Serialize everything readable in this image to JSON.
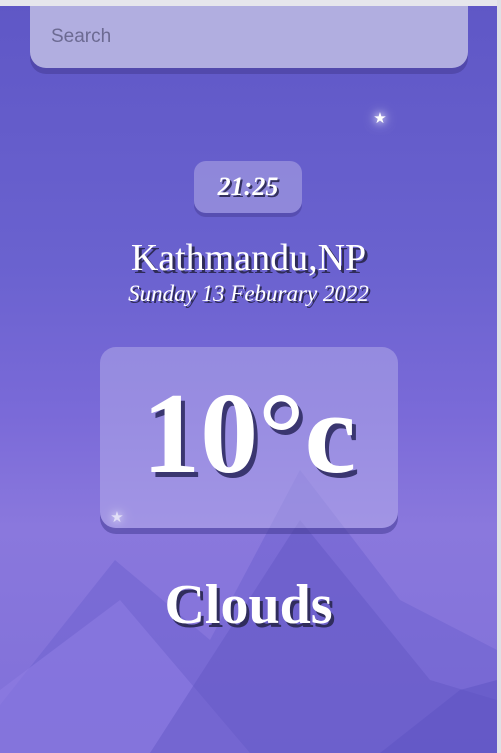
{
  "search": {
    "placeholder": "Search"
  },
  "weather": {
    "time": "21:25",
    "location": "Kathmandu,NP",
    "date": "Sunday 13 Feburary 2022",
    "temperature": "10°c",
    "condition": "Clouds"
  },
  "icons": [
    "star-icon",
    "star-icon",
    "mountain-background"
  ],
  "colors": {
    "background_top": "#5f57c6",
    "background_bottom": "#8a78dd",
    "panel": "#b1aee0",
    "text": "#ffffff"
  }
}
